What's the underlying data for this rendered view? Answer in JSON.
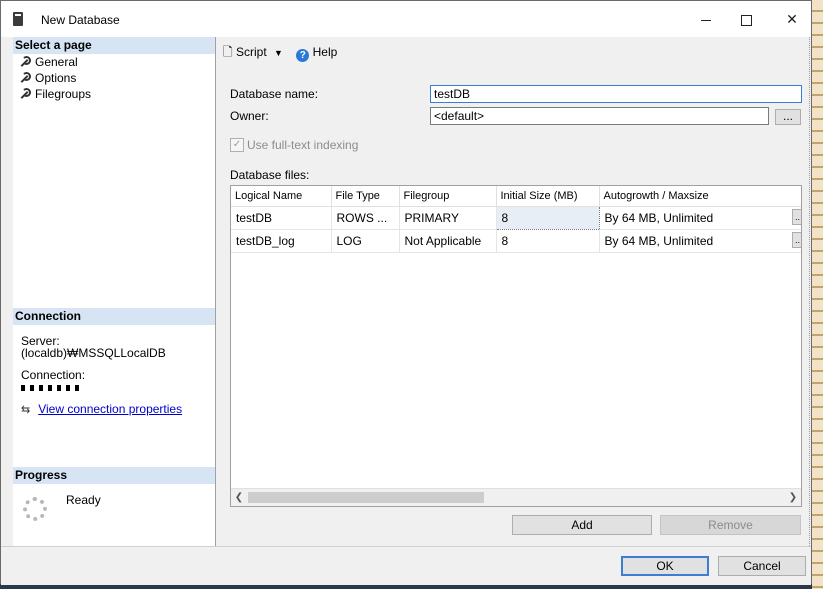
{
  "window": {
    "title": "New Database"
  },
  "sidebar": {
    "select_page": "Select a page",
    "items": [
      {
        "label": "General"
      },
      {
        "label": "Options"
      },
      {
        "label": "Filegroups"
      }
    ],
    "connection_header": "Connection",
    "server_label": "Server:",
    "server_value": "(localdb)₩MSSQLLocalDB",
    "connection_label": "Connection:",
    "view_props": "View connection properties",
    "progress_header": "Progress",
    "progress_status": "Ready"
  },
  "toolbar": {
    "script": "Script",
    "help": "Help"
  },
  "form": {
    "db_name_label": "Database name:",
    "db_name_value": "testDB",
    "owner_label": "Owner:",
    "owner_value": "<default>",
    "browse": "...",
    "fulltext_label": "Use full-text indexing",
    "files_label": "Database files:"
  },
  "grid": {
    "columns": [
      "Logical Name",
      "File Type",
      "Filegroup",
      "Initial Size (MB)",
      "Autogrowth / Maxsize"
    ],
    "rows": [
      [
        "testDB",
        "ROWS ...",
        "PRIMARY",
        "8",
        "By 64 MB, Unlimited"
      ],
      [
        "testDB_log",
        "LOG",
        "Not Applicable",
        "8",
        "By 64 MB, Unlimited"
      ]
    ]
  },
  "buttons": {
    "add": "Add",
    "remove": "Remove",
    "ok": "OK",
    "cancel": "Cancel"
  }
}
